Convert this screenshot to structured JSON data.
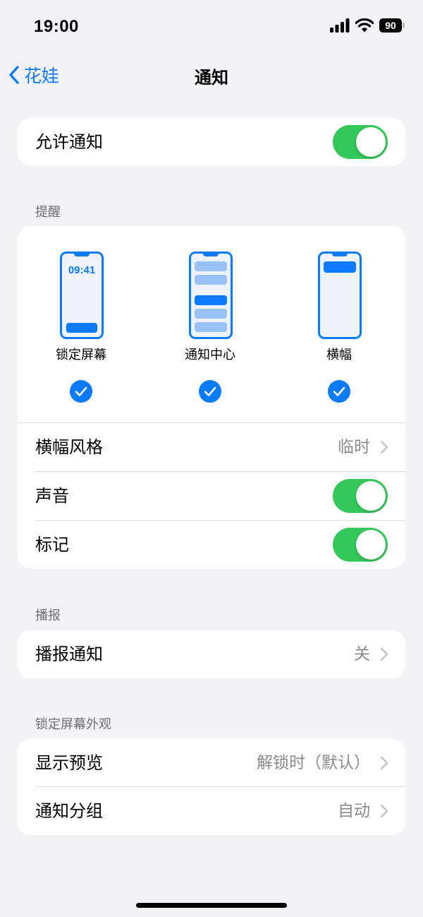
{
  "status_bar": {
    "time": "19:00",
    "battery": "90"
  },
  "nav": {
    "back_label": "花娃",
    "title": "通知"
  },
  "allow_notifications": {
    "label": "允许通知",
    "enabled": true
  },
  "alerts": {
    "header": "提醒",
    "options": [
      {
        "label": "锁定屏幕",
        "phone_time": "09:41",
        "checked": true
      },
      {
        "label": "通知中心",
        "checked": true
      },
      {
        "label": "横幅",
        "checked": true
      }
    ],
    "banner_style": {
      "label": "横幅风格",
      "value": "临时"
    },
    "sounds": {
      "label": "声音",
      "enabled": true
    },
    "badges": {
      "label": "标记",
      "enabled": true
    }
  },
  "announce": {
    "header": "播报",
    "announce_notifications": {
      "label": "播报通知",
      "value": "关"
    }
  },
  "lock_screen_appearance": {
    "header": "锁定屏幕外观",
    "show_previews": {
      "label": "显示预览",
      "value": "解锁时（默认）"
    },
    "notification_grouping": {
      "label": "通知分组",
      "value": "自动"
    }
  },
  "colors": {
    "accent": "#0a7aff",
    "toggle_on": "#34c759",
    "background": "#f2f2f7",
    "secondary_text": "#8a8a8e"
  }
}
